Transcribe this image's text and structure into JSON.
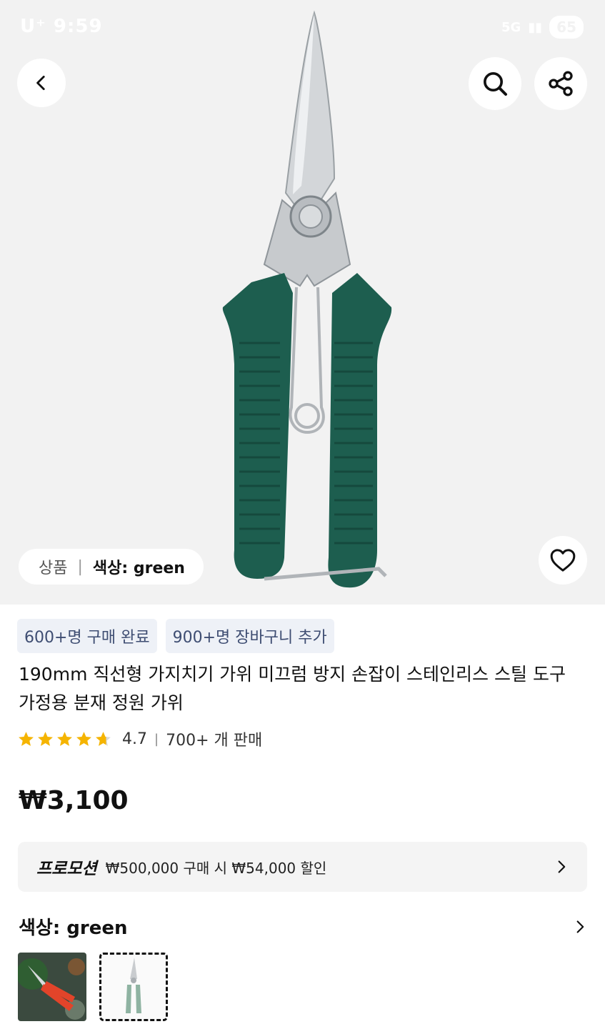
{
  "status_bar": {
    "carrier": "U⁺ 9:59",
    "network": "5G",
    "battery": "65"
  },
  "icons": {
    "back": "chevron-left-icon",
    "search": "search-icon",
    "share": "share-icon",
    "favorite": "heart-icon",
    "promo_chevron": "chevron-right-icon",
    "color_chevron": "chevron-right-icon"
  },
  "hero": {
    "variant_label": "상품",
    "variant_value": "색상: green"
  },
  "badges": [
    "600+명 구매 완료",
    "900+명 장바구니 추가"
  ],
  "product": {
    "title": "190mm 직선형 가지치기 가위 미끄럼 방지 손잡이 스테인리스 스틸 도구 가정용 분재 정원 가위",
    "rating": "4.7",
    "rating_value": 4.7,
    "sold": "700+ 개 판매",
    "price": "₩3,100"
  },
  "promo": {
    "tag": "프로모션",
    "text": "₩500,000 구매 시 ₩54,000 할인"
  },
  "color_option": {
    "label": "색상: green"
  },
  "colors": {
    "handle_green": "#1d5e4f",
    "steel": "#c9cccf",
    "star": "#f5b400",
    "badge_bg": "#eef1f7",
    "badge_text": "#3e4d72",
    "thumb_red": "#e2442a"
  }
}
